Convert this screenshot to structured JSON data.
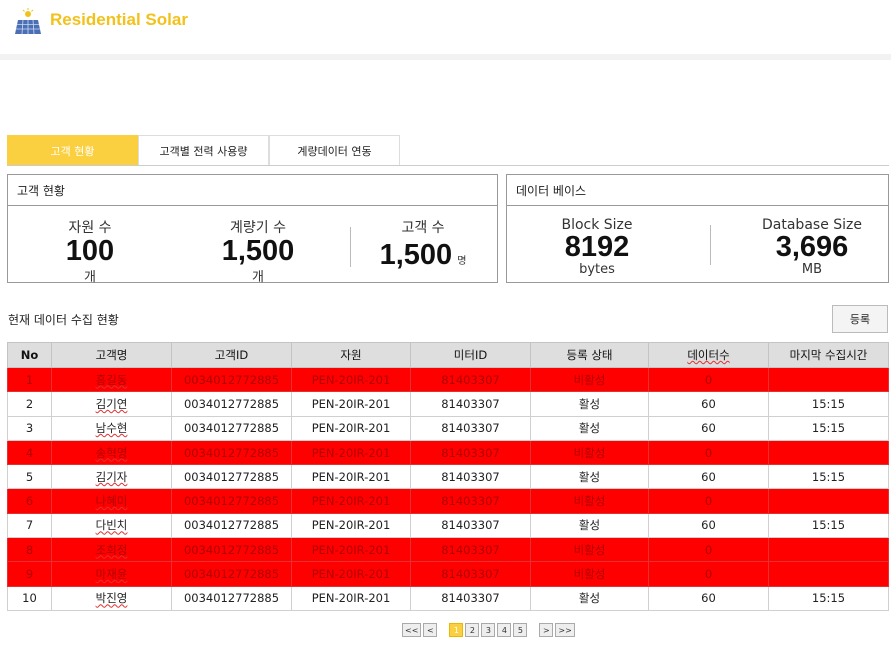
{
  "header": {
    "brand": "Residential Solar"
  },
  "tabs": [
    {
      "label": "고객 현황"
    },
    {
      "label": "고객별 전력 사용량"
    },
    {
      "label": "계량데이터 연동"
    }
  ],
  "customer_panel": {
    "title": "고객 현황",
    "stats": [
      {
        "label": "자원 수",
        "value": "100",
        "unit": "개"
      },
      {
        "label": "계량기 수",
        "value": "1,500",
        "unit": "개"
      },
      {
        "label": "고객 수",
        "value": "1,500",
        "unit": "명"
      }
    ]
  },
  "db_panel": {
    "title": "데이터 베이스",
    "stats": [
      {
        "label": "Block Size",
        "value": "8192",
        "unit": "bytes"
      },
      {
        "label": "Database Size",
        "value": "3,696",
        "unit": "MB"
      }
    ]
  },
  "collection": {
    "title": "현재 데이터 수집 현황",
    "register_label": "등록",
    "columns": [
      "No",
      "고객명",
      "고객ID",
      "자원",
      "미터ID",
      "등록 상태",
      "데이터수",
      "마지막 수집시간"
    ],
    "rows": [
      [
        "1",
        "홍길동",
        "0034012772885",
        "PEN-20IR-201",
        "81403307",
        "비활성",
        "0",
        ""
      ],
      [
        "2",
        "김기연",
        "0034012772885",
        "PEN-20IR-201",
        "81403307",
        "활성",
        "60",
        "15:15"
      ],
      [
        "3",
        "남수현",
        "0034012772885",
        "PEN-20IR-201",
        "81403307",
        "활성",
        "60",
        "15:15"
      ],
      [
        "4",
        "송혁명",
        "0034012772885",
        "PEN-20IR-201",
        "81403307",
        "비활성",
        "0",
        ""
      ],
      [
        "5",
        "김기자",
        "0034012772885",
        "PEN-20IR-201",
        "81403307",
        "활성",
        "60",
        "15:15"
      ],
      [
        "6",
        "나혜미",
        "0034012772885",
        "PEN-20IR-201",
        "81403307",
        "비활성",
        "0",
        ""
      ],
      [
        "7",
        "다빈치",
        "0034012772885",
        "PEN-20IR-201",
        "81403307",
        "활성",
        "60",
        "15:15"
      ],
      [
        "8",
        "조희정",
        "0034012772885",
        "PEN-20IR-201",
        "81403307",
        "비활성",
        "0",
        ""
      ],
      [
        "9",
        "마재윤",
        "0034012772885",
        "PEN-20IR-201",
        "81403307",
        "비활성",
        "0",
        ""
      ],
      [
        "10",
        "박진영",
        "0034012772885",
        "PEN-20IR-201",
        "81403307",
        "활성",
        "60",
        "15:15"
      ]
    ],
    "inactive_color": "#ff0000"
  },
  "pager": {
    "first": "<<",
    "prev": "<",
    "pages": [
      "1",
      "2",
      "3",
      "4",
      "5"
    ],
    "current": "1",
    "next": ">",
    "last": ">>"
  },
  "colors": {
    "accent": "#fbd040",
    "brand": "#f2c21c"
  }
}
